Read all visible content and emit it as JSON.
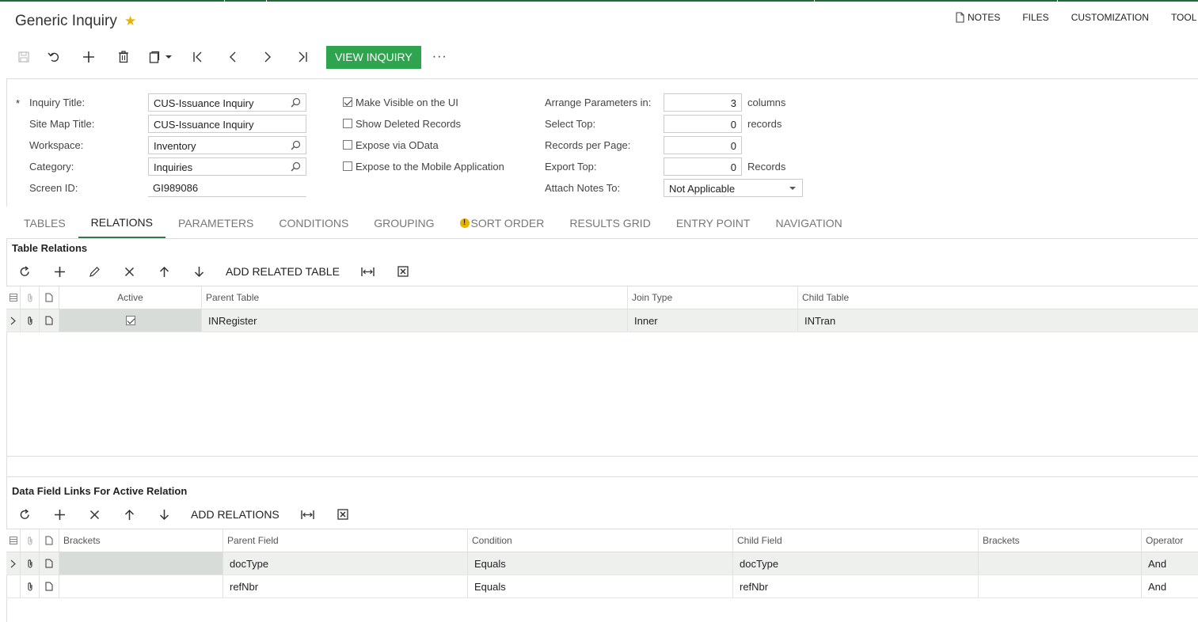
{
  "page": {
    "title": "Generic Inquiry",
    "top_links": [
      {
        "label": "NOTES",
        "icon": "document-icon"
      },
      {
        "label": "FILES"
      },
      {
        "label": "CUSTOMIZATION"
      },
      {
        "label": "TOOL"
      }
    ]
  },
  "toolbar": {
    "icons": [
      "save-icon",
      "undo-icon",
      "plus-icon",
      "trash-icon",
      "clipboard-icon",
      "first-icon",
      "prev-icon",
      "next-icon",
      "last-icon"
    ],
    "view_inquiry": "VIEW INQUIRY",
    "more": "···"
  },
  "form": {
    "required_mark": "*",
    "inquiry_title_label": "Inquiry Title:",
    "inquiry_title_value": "CUS-Issuance Inquiry",
    "site_map_title_label": "Site Map Title:",
    "site_map_title_value": "CUS-Issuance Inquiry",
    "workspace_label": "Workspace:",
    "workspace_value": "Inventory",
    "category_label": "Category:",
    "category_value": "Inquiries",
    "screen_id_label": "Screen ID:",
    "screen_id_value": "GI989086",
    "make_visible_label": "Make Visible on the UI",
    "make_visible_checked": true,
    "show_deleted_label": "Show Deleted Records",
    "show_deleted_checked": false,
    "expose_odata_label": "Expose via OData",
    "expose_odata_checked": false,
    "expose_mobile_label": "Expose to the Mobile Application",
    "expose_mobile_checked": false,
    "arrange_label": "Arrange Parameters in:",
    "arrange_value": "3",
    "arrange_unit": "columns",
    "select_top_label": "Select Top:",
    "select_top_value": "0",
    "select_top_unit": "records",
    "records_per_page_label": "Records per Page:",
    "records_per_page_value": "0",
    "export_top_label": "Export Top:",
    "export_top_value": "0",
    "export_top_unit": "Records",
    "attach_notes_label": "Attach Notes To:",
    "attach_notes_value": "Not Applicable"
  },
  "tabs": [
    {
      "label": "TABLES"
    },
    {
      "label": "RELATIONS",
      "active": true
    },
    {
      "label": "PARAMETERS"
    },
    {
      "label": "CONDITIONS"
    },
    {
      "label": "GROUPING"
    },
    {
      "label": "SORT ORDER",
      "warning": "!"
    },
    {
      "label": "RESULTS GRID"
    },
    {
      "label": "ENTRY POINT"
    },
    {
      "label": "NAVIGATION"
    }
  ],
  "table_relations": {
    "title": "Table Relations",
    "add_button": "ADD RELATED TABLE",
    "columns": {
      "active": "Active",
      "parent_table": "Parent Table",
      "join_type": "Join Type",
      "child_table": "Child Table"
    },
    "rows": [
      {
        "active": true,
        "parent_table": "INRegister",
        "join_type": "Inner",
        "child_table": "INTran"
      }
    ]
  },
  "data_field_links": {
    "title": "Data Field Links For Active Relation",
    "add_button": "ADD RELATIONS",
    "columns": {
      "brackets_open": "Brackets",
      "parent_field": "Parent Field",
      "condition": "Condition",
      "child_field": "Child Field",
      "brackets_close": "Brackets",
      "operator": "Operator"
    },
    "rows": [
      {
        "brackets_open": "",
        "parent_field": "docType",
        "condition": "Equals",
        "child_field": "docType",
        "brackets_close": "",
        "operator": "And"
      },
      {
        "brackets_open": "",
        "parent_field": "refNbr",
        "condition": "Equals",
        "child_field": "refNbr",
        "brackets_close": "",
        "operator": "And"
      }
    ]
  },
  "colors": {
    "accent": "#2ea44f",
    "star": "#e8b200",
    "tab_underline": "#2e7d45"
  }
}
